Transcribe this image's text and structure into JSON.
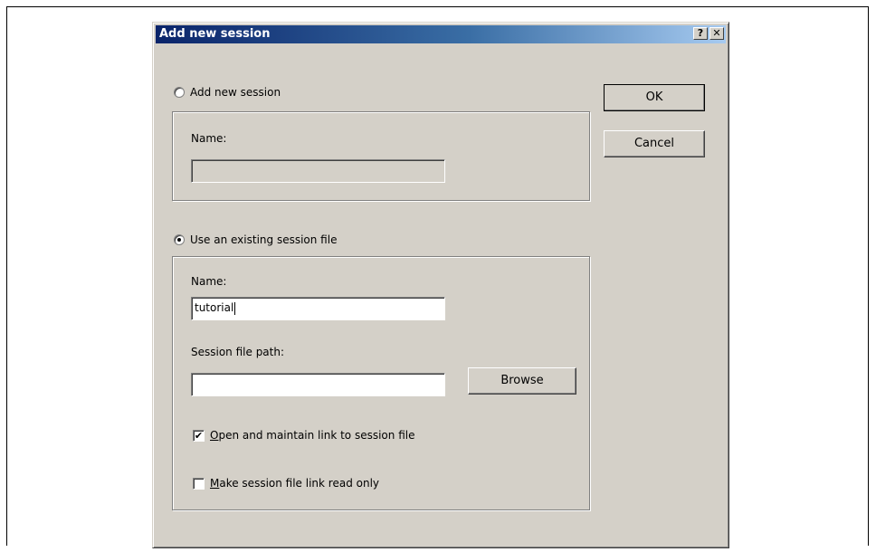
{
  "dialog": {
    "title": "Add new session",
    "help_label": "?",
    "close_label": "✕"
  },
  "new_session": {
    "radio_label": "Add new session",
    "selected": false,
    "name_label": "Name:",
    "name_value": ""
  },
  "existing_session": {
    "radio_label": "Use an existing session file",
    "selected": true,
    "name_label": "Name:",
    "name_value": "tutorial",
    "path_label": "Session file path:",
    "path_value": "",
    "browse_label": "Browse",
    "open_link": {
      "mnemonic": "O",
      "rest": "pen and maintain link to session file",
      "checked": true
    },
    "read_only": {
      "mnemonic": "M",
      "rest": "ake session file link read only",
      "checked": false
    }
  },
  "buttons": {
    "ok_label": "OK",
    "cancel_label": "Cancel"
  },
  "check_glyph": "✔"
}
